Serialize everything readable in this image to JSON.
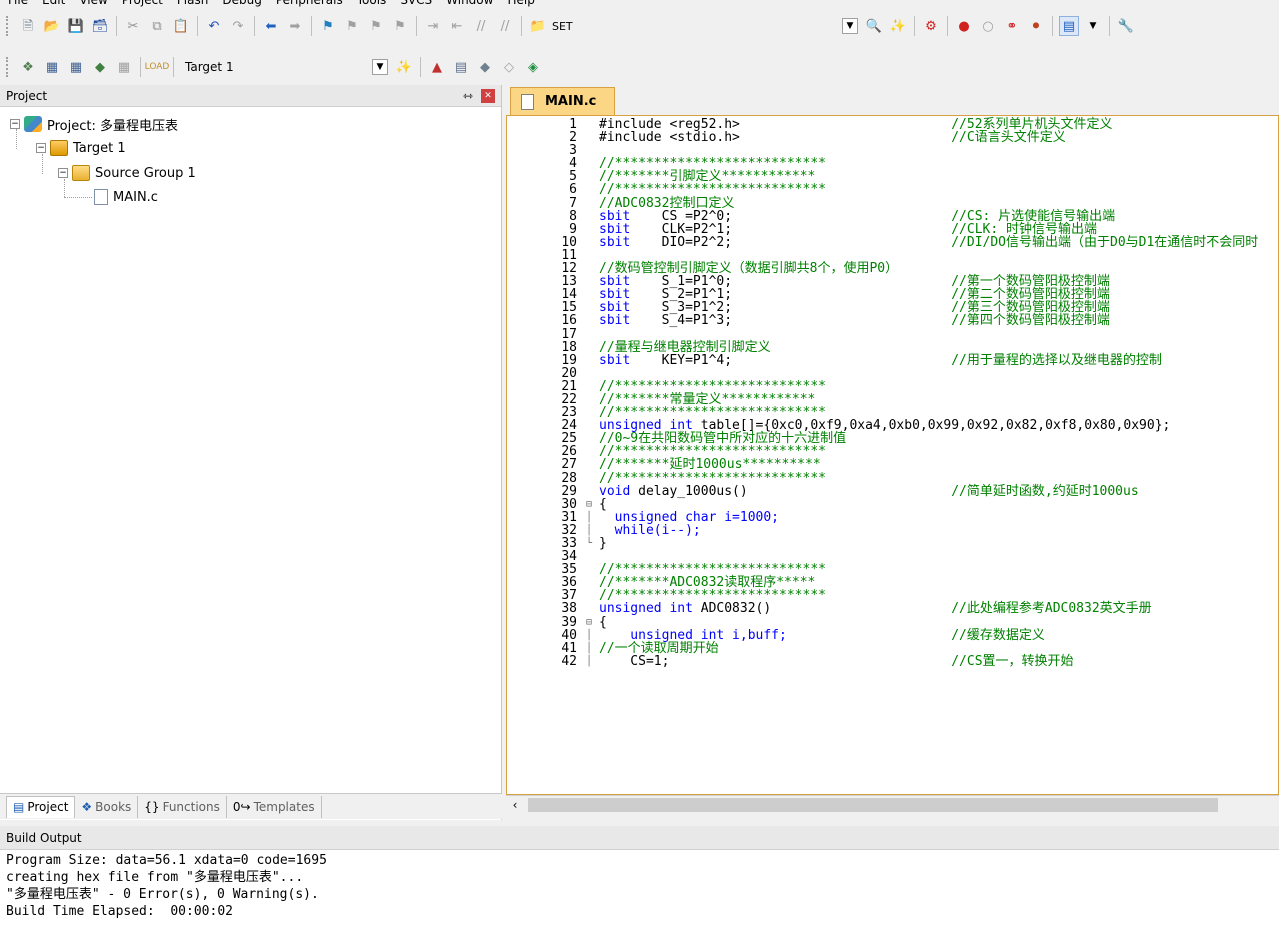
{
  "menu": [
    "File",
    "Edit",
    "View",
    "Project",
    "Flash",
    "Debug",
    "Peripherals",
    "Tools",
    "SVCS",
    "Window",
    "Help"
  ],
  "toolbar1": {
    "set_label": "SET"
  },
  "toolbar2": {
    "target_value": "Target 1"
  },
  "project_panel": {
    "title": "Project",
    "tree": {
      "project_label": "Project: 多量程电压表",
      "target_label": "Target 1",
      "group_label": "Source Group 1",
      "file_label": "MAIN.c"
    },
    "tabs": [
      "Project",
      "Books",
      "Functions",
      "Templates"
    ]
  },
  "editor": {
    "tab_label": "MAIN.c",
    "lines": [
      {
        "n": "1",
        "code": "#include <reg52.h>",
        "cm": "//52系列单片机头文件定义"
      },
      {
        "n": "2",
        "code": "#include <stdio.h>",
        "cm": "//C语言头文件定义"
      },
      {
        "n": "3",
        "code": "",
        "cm": ""
      },
      {
        "n": "4",
        "code": "",
        "cm": "//***************************"
      },
      {
        "n": "5",
        "code": "",
        "cm": "//*******引脚定义************"
      },
      {
        "n": "6",
        "code": "",
        "cm": "//***************************"
      },
      {
        "n": "7",
        "code": "",
        "cm": "//ADC0832控制口定义"
      },
      {
        "n": "8",
        "kw": "sbit",
        "code": "    CS =P2^0;",
        "cm": "//CS: 片选使能信号输出端"
      },
      {
        "n": "9",
        "kw": "sbit",
        "code": "    CLK=P2^1;",
        "cm": "//CLK: 时钟信号输出端"
      },
      {
        "n": "10",
        "kw": "sbit",
        "code": "    DIO=P2^2;",
        "cm": "//DI/DO信号输出端（由于D0与D1在通信时不会同时"
      },
      {
        "n": "11",
        "code": "",
        "cm": ""
      },
      {
        "n": "12",
        "code": "",
        "cm": "//数码管控制引脚定义（数据引脚共8个，使用P0）"
      },
      {
        "n": "13",
        "kw": "sbit",
        "code": "    S_1=P1^0;",
        "cm": "//第一个数码管阳极控制端"
      },
      {
        "n": "14",
        "kw": "sbit",
        "code": "    S_2=P1^1;",
        "cm": "//第二个数码管阳极控制端"
      },
      {
        "n": "15",
        "kw": "sbit",
        "code": "    S_3=P1^2;",
        "cm": "//第三个数码管阳极控制端"
      },
      {
        "n": "16",
        "kw": "sbit",
        "code": "    S_4=P1^3;",
        "cm": "//第四个数码管阳极控制端"
      },
      {
        "n": "17",
        "code": "",
        "cm": ""
      },
      {
        "n": "18",
        "code": "",
        "cm": "//量程与继电器控制引脚定义"
      },
      {
        "n": "19",
        "kw": "sbit",
        "code": "    KEY=P1^4;",
        "cm": "//用于量程的选择以及继电器的控制"
      },
      {
        "n": "20",
        "code": "",
        "cm": ""
      },
      {
        "n": "21",
        "code": "",
        "cm": "//***************************"
      },
      {
        "n": "22",
        "code": "",
        "cm": "//*******常量定义************"
      },
      {
        "n": "23",
        "code": "",
        "cm": "//***************************"
      },
      {
        "n": "24",
        "kw": "unsigned int",
        "code": " table[]={0xc0,0xf9,0xa4,0xb0,0x99,0x92,0x82,0xf8,0x80,0x90};",
        "cm": ""
      },
      {
        "n": "25",
        "code": "",
        "cm": "//0~9在共阳数码管中所对应的十六进制值"
      },
      {
        "n": "26",
        "code": "",
        "cm": "//***************************"
      },
      {
        "n": "27",
        "code": "",
        "cm": "//*******延时1000us**********"
      },
      {
        "n": "28",
        "code": "",
        "cm": "//***************************"
      },
      {
        "n": "29",
        "kw": "void",
        "code": " delay_1000us()",
        "cm": "//简单延时函数,约延时1000us"
      },
      {
        "n": "30",
        "code": "{",
        "cm": "",
        "fold": "⊟"
      },
      {
        "n": "31",
        "code": "  unsigned char i=1000;",
        "cm": "",
        "fold": "│"
      },
      {
        "n": "32",
        "code": "  while(i--);",
        "cm": "",
        "fold": "│"
      },
      {
        "n": "33",
        "code": "}",
        "cm": "",
        "fold": "└"
      },
      {
        "n": "34",
        "code": "",
        "cm": ""
      },
      {
        "n": "35",
        "code": "",
        "cm": "//***************************"
      },
      {
        "n": "36",
        "code": "",
        "cm": "//*******ADC0832读取程序*****"
      },
      {
        "n": "37",
        "code": "",
        "cm": "//***************************"
      },
      {
        "n": "38",
        "kw": "unsigned int",
        "code": " ADC0832()",
        "cm": "//此处编程参考ADC0832英文手册"
      },
      {
        "n": "39",
        "code": "{",
        "cm": "",
        "fold": "⊟"
      },
      {
        "n": "40",
        "code": "    unsigned int i,buff;",
        "cm": "//缓存数据定义",
        "fold": "│"
      },
      {
        "n": "41",
        "code": "",
        "cm": "//一个读取周期开始",
        "fold": "│"
      },
      {
        "n": "42",
        "code": "    CS=1;",
        "cm": "//CS置一，转换开始",
        "fold": "│"
      }
    ]
  },
  "build": {
    "title": "Build Output",
    "lines": [
      "Program Size: data=56.1 xdata=0 code=1695",
      "creating hex file from \"多量程电压表\"...",
      "\"多量程电压表\" - 0 Error(s), 0 Warning(s).",
      "Build Time Elapsed:  00:00:02"
    ]
  }
}
